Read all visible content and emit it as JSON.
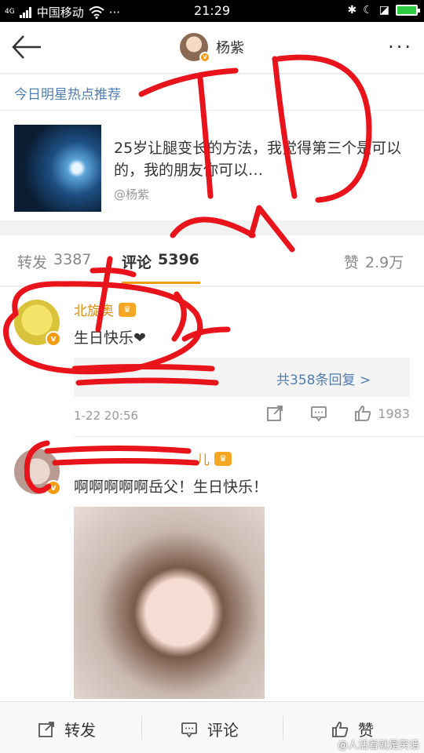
{
  "status_bar": {
    "signal_label": "4G",
    "carrier": "中国移动",
    "dots": "···",
    "time": "21:29"
  },
  "nav": {
    "title": "杨紫",
    "more": "···"
  },
  "hot_recommend": {
    "label": "今日明星热点推荐"
  },
  "article": {
    "text": "25岁让腿变长的方法，我觉得第三个是可以的，我的朋友你可以…",
    "author": "@杨紫"
  },
  "tabs": [
    {
      "label": "转发",
      "count": "3387"
    },
    {
      "label": "评论",
      "count": "5396"
    },
    {
      "label": "赞",
      "count": "2.9万"
    }
  ],
  "comments": [
    {
      "name": "北旋奥",
      "text": "生日快乐❤",
      "reply_summary": "共358条回复 >",
      "time": "1-22 20:56",
      "likes": "1983"
    },
    {
      "name": "儿",
      "text": "啊啊啊啊啊岳父！生日快乐！"
    }
  ],
  "bottom_bar": {
    "repost": "转发",
    "comment": "评论",
    "like": "赞"
  },
  "watermark": "@人活着就是笑话",
  "colors": {
    "link_blue": "#507daf",
    "name_gold": "#e08e0b",
    "annotation_red": "#e8131b"
  }
}
